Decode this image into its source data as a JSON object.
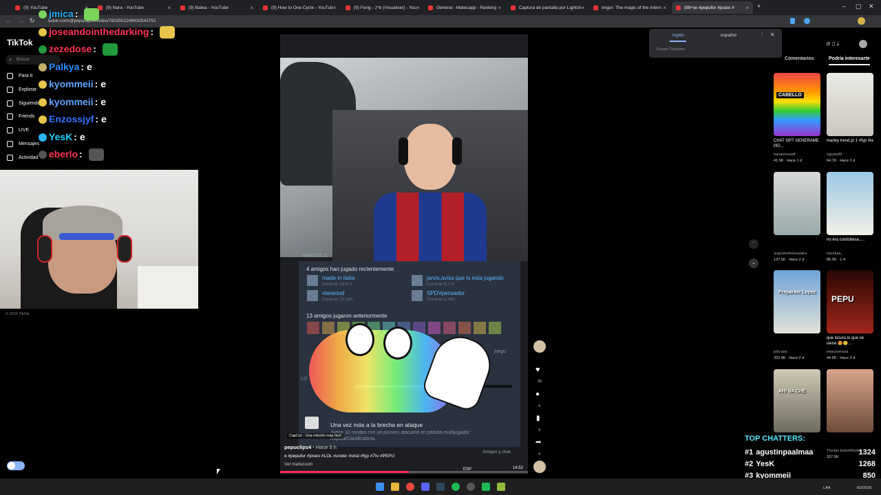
{
  "tabs": [
    {
      "label": "(9) YouTube",
      "active": false
    },
    {
      "label": "(9) Nara - YouTube",
      "active": false
    },
    {
      "label": "(9) Batea - YouTube",
      "active": false
    },
    {
      "label": "(9) How to One Cycle - YouTub",
      "active": false
    },
    {
      "label": "(9) Feng - J^b (Visualiser) - You",
      "active": false
    },
    {
      "label": "General - Matecapp - Ranking",
      "active": false
    },
    {
      "label": "Captura de pantalla por Lightsh",
      "active": false
    },
    {
      "label": "Imgur: The magic of the Intern",
      "active": false
    },
    {
      "label": "(99+)e #pepufor #joseo #",
      "active": true
    }
  ],
  "url": "tiktok.com/@pepuclips4/video/7603502248932543751",
  "sidebar": {
    "logo": "TikTok",
    "search_placeholder": "Buscar",
    "items": [
      "Para ti",
      "Explorar",
      "Siguiendo",
      "Friends",
      "LIVE",
      "Mensajes",
      "Actividad"
    ],
    "copyright": "© 2026 TikTok"
  },
  "chat": [
    {
      "name": "jmica",
      "text": "",
      "color": "#2db4ff"
    },
    {
      "name": "joseandointhedarking",
      "text": "",
      "color": "#ff3355"
    },
    {
      "name": "zezedose",
      "text": "",
      "color": "#ff3355"
    },
    {
      "name": "Palkya",
      "text": "e",
      "color": "#2d8cff"
    },
    {
      "name": "kyommeii",
      "text": "e",
      "color": "#5da6ff"
    },
    {
      "name": "kyommeii",
      "text": "e",
      "color": "#5da6ff"
    },
    {
      "name": "Enzossjyf",
      "text": "e",
      "color": "#2d74ff"
    },
    {
      "name": "YesK",
      "text": "e",
      "color": "#1fd0ff"
    },
    {
      "name": "eberlo",
      "text": "",
      "color": "#ff3355"
    }
  ],
  "video": {
    "friends_header": "AMIGOS C",
    "recent_title": "4 amigos han jugado recientemente",
    "friends": [
      {
        "name": "made in italia",
        "time": "Durante 14,9 h"
      },
      {
        "name": "jarvis,avisa que tx esta jugando",
        "time": "Durante 6,2 h"
      },
      {
        "name": "vlaneood",
        "time": "Durante 25 min"
      },
      {
        "name": "SPDVpensador",
        "time": "Durante 2 min"
      }
    ],
    "older_title": "13 amigos jugaron anteriormente",
    "year_badge": "2026",
    "played_partial": "juego",
    "achievement_title": "Una vez más a la brecha en ataque",
    "achievement_desc": "Juega 10 rondas con un pionero atacante en partida multijugador",
    "achievement_desc2": "Rápida/Clasificatoria.",
    "capcut": "CapCut · Una edición más fácil",
    "friends_chat": "Amigos y chat",
    "clock": "14:52",
    "lang": "ESP",
    "lo_partial": "LO",
    "author": "pepuclips4",
    "time_ago": "Hace 5 h",
    "caption": "e #pepufor #joseo #LOL #under #viral #fyp #7tv #PEPU",
    "translate": "Ver traducción"
  },
  "actions": {
    "likes": "35",
    "comments": "4",
    "saves": "3",
    "shares": "4"
  },
  "translate_popup": {
    "lang1": "inglés",
    "lang2": "español",
    "footer": "Google Translate"
  },
  "right_tabs": [
    "Comentarios",
    "Podría interesarte"
  ],
  "suggestions": [
    {
      "caption": "CHAT GPT GENERAME PEI...",
      "author": "bananirouwtf",
      "stats": "41.9K · Hace 1 d",
      "overlay": "CABELLO"
    },
    {
      "caption": "marley trend pt 1 #fyp #la",
      "author": "ngiuito89",
      "stats": "64.7K · Hace 2 d",
      "overlay": ""
    },
    {
      "caption": "",
      "author": "augustoalonsoyatra",
      "stats": "137.5K · Hace 2 d",
      "overlay": ""
    },
    {
      "caption": "no era cordobesa.....",
      "author": "naczkaa_",
      "stats": "85.3K · 1-4",
      "overlay": ""
    },
    {
      "caption": "",
      "author": "jolly.arts",
      "stats": "332.9K · Hace 2 d",
      "overlay": "Preparate Lopez"
    },
    {
      "caption": "que locura lo que se viene 😍🥲...",
      "author": "pepusomoza",
      "stats": "44.6K · Hace 2 d",
      "overlay": "PEPU"
    },
    {
      "caption": "",
      "author": "",
      "stats": "",
      "overlay": "AHI VA CHE"
    },
    {
      "caption": "",
      "author": "Thelian bobo#thelian...",
      "stats": "337.5K",
      "overlay": ""
    }
  ],
  "top_chatters": {
    "title": "TOP CHATTERS:",
    "rows": [
      {
        "rank": "#1",
        "name": "agustinpaalmaa",
        "count": "1324"
      },
      {
        "rank": "#2",
        "name": "YesK",
        "count": "1268"
      },
      {
        "rank": "#3",
        "name": "kyommeii",
        "count": "850"
      }
    ]
  },
  "taskbar": {
    "lang": "LAA",
    "date": "6/2/2026"
  },
  "colors": {
    "tiktok_red": "#fe2c55",
    "steam_blue": "#66c0f4",
    "chrome_dark": "#202124"
  }
}
